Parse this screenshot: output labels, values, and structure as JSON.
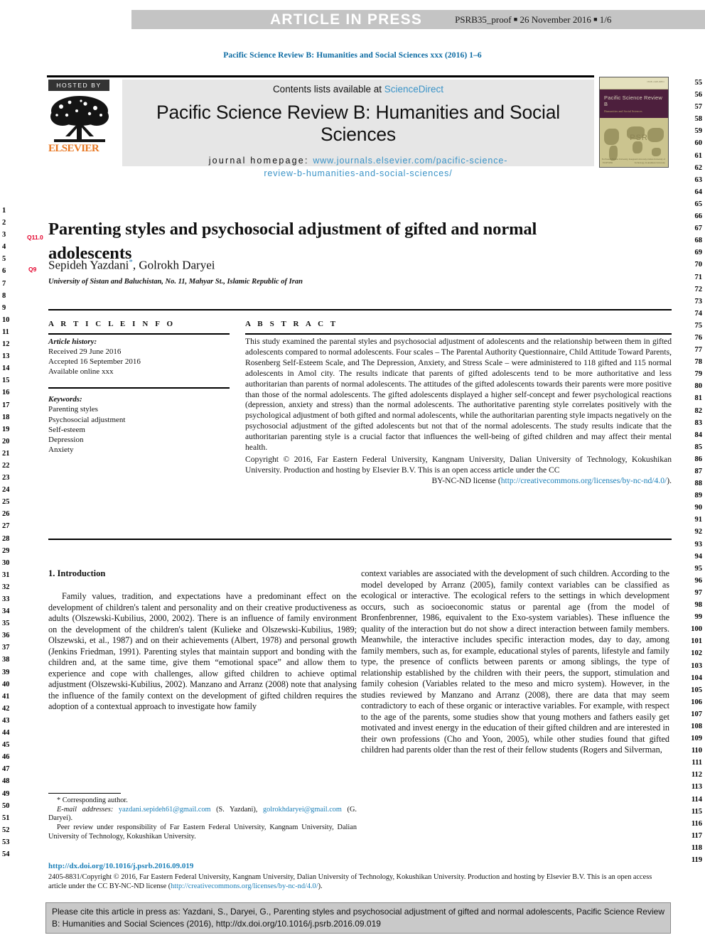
{
  "banner": {
    "label": "ARTICLE IN PRESS",
    "proof_id": "PSRB35_proof",
    "proof_date": "26 November 2016",
    "proof_page": "1/6"
  },
  "running_head": "Pacific Science Review B: Humanities and Social Sciences xxx (2016) 1–6",
  "masthead": {
    "hosted_by": "HOSTED BY",
    "publisher": "ELSEVIER",
    "contents_prefix": "Contents lists available at ",
    "contents_link": "ScienceDirect",
    "journal_title": "Pacific Science Review B: Humanities and Social Sciences",
    "homepage_label": "journal homepage: ",
    "homepage_url_line1": "www.journals.elsevier.com/pacific-science-",
    "homepage_url_line2": "review-b-humanities-and-social-sciences/"
  },
  "cover": {
    "title": "Pacific Science Review B",
    "subtitle": "Humanities and Social Sciences",
    "mark": "PSR",
    "footer": "Far Eastern Federal University, Kangnam University,\nDalian University of Technology, Kokushikan University",
    "publisher": "ELSEVIER"
  },
  "article": {
    "title": "Parenting styles and psychosocial adjustment of gifted and normal adolescents",
    "query_tag_title": "Q11.0",
    "query_tag_authors": "Q9",
    "authors": "Sepideh Yazdani, Golrokh Daryei",
    "author_1": "Sepideh Yazdani",
    "author_1_mark": "*",
    "author_2": "Golrokh Daryei",
    "affiliation": "University of Sistan and Baluchistan, No. 11, Mahyar St., Islamic Republic of Iran"
  },
  "info": {
    "heading": "A R T I C L E   I N F O",
    "history_label": "Article history:",
    "received": "Received 29 June 2016",
    "accepted": "Accepted 16 September 2016",
    "available": "Available online xxx",
    "keywords_label": "Keywords:",
    "keywords": [
      "Parenting styles",
      "Psychosocial adjustment",
      "Self-esteem",
      "Depression",
      "Anxiety"
    ]
  },
  "abstract": {
    "heading": "A B S T R A C T",
    "body": "This study examined the parental styles and psychosocial adjustment of adolescents and the relationship between them in gifted adolescents compared to normal adolescents. Four scales – The Parental Authority Questionnaire, Child Attitude Toward Parents, Rosenberg Self-Esteem Scale, and The Depression, Anxiety, and Stress Scale – were administered to 118 gifted and 115 normal adolescents in Amol city. The results indicate that parents of gifted adolescents tend to be more authoritative and less authoritarian than parents of normal adolescents. The attitudes of the gifted adolescents towards their parents were more positive than those of the normal adolescents. The gifted adolescents displayed a higher self-concept and fewer psychological reactions (depression, anxiety and stress) than the normal adolescents. The authoritative parenting style correlates positively with the psychological adjustment of both gifted and normal adolescents, while the authoritarian parenting style impacts negatively on the psychosocial adjustment of the gifted adolescents but not that of the normal adolescents. The study results indicate that the authoritarian parenting style is a crucial factor that influences the well-being of gifted children and may affect their mental health.",
    "copyright": "Copyright © 2016, Far Eastern Federal University, Kangnam University, Dalian University of Technology, Kokushikan University. Production and hosting by Elsevier B.V. This is an open access article under the CC",
    "license_prefix": "BY-NC-ND license (",
    "license_url": "http://creativecommons.org/licenses/by-nc-nd/4.0/",
    "license_suffix": ")."
  },
  "body": {
    "section_heading": "1. Introduction",
    "left_paragraph": "Family values, tradition, and expectations have a predominant effect on the development of children's talent and personality and on their creative productiveness as adults (Olszewski-Kubilius, 2000, 2002). There is an influence of family environment on the development of the children's talent (Kulieke and Olszewski-Kubilius, 1989; Olszewski, et al., 1987) and on their achievements (Albert, 1978) and personal growth (Jenkins Friedman, 1991). Parenting styles that maintain support and bonding with the children and, at the same time, give them “emotional space” and allow them to experience and cope with challenges, allow gifted children to achieve optimal adjustment (Olszewski-Kubilius, 2002). Manzano and Arranz (2008) note that analysing the influence of the family context on the development of gifted children requires the adoption of a contextual approach to investigate how family",
    "right_paragraph": "context variables are associated with the development of such children. According to the model developed by Arranz (2005), family context variables can be classified as ecological or interactive. The ecological refers to the settings in which development occurs, such as socioeconomic status or parental age (from the model of Bronfenbrenner, 1986, equivalent to the Exo-system variables). These influence the quality of the interaction but do not show a direct interaction between family members. Meanwhile, the interactive includes specific interaction modes, day to day, among family members, such as, for example, educational styles of parents, lifestyle and family type, the presence of conflicts between parents or among siblings, the type of relationship established by the children with their peers, the support, stimulation and family cohesion (Variables related to the meso and micro system). However, in the studies reviewed by Manzano and Arranz (2008), there are data that may seem contradictory to each of these organic or interactive variables. For example, with respect to the age of the parents, some studies show that young mothers and fathers easily get motivated and invest energy in the education of their gifted children and are interested in their own professions (Cho and Yoon, 2005), while other studies found that gifted children had parents older than the rest of their fellow students (Rogers and Silverman,"
  },
  "footnote": {
    "corresponding": "* Corresponding author.",
    "email_label": "E-mail addresses:",
    "email_1": "yazdani.sepideh61@gmail.com",
    "email_1_name": "(S. Yazdani),",
    "email_2": "golrokhdaryei@gmail.com",
    "email_2_name": "(G. Daryei).",
    "peer_review": "Peer review under responsibility of Far Eastern Federal University, Kangnam University, Dalian University of Technology, Kokushikan University.",
    "doi": "http://dx.doi.org/10.1016/j.psrb.2016.09.019",
    "copyright": "2405-8831/Copyright © 2016, Far Eastern Federal University, Kangnam University, Dalian University of Technology, Kokushikan University. Production and hosting by Elsevier B.V. This is an open access article under the CC BY-NC-ND license (",
    "copyright_url": "http://creativecommons.org/licenses/by-nc-nd/4.0/",
    "copyright_tail": ")."
  },
  "cite_box": {
    "text": "Please cite this article in press as: Yazdani, S., Daryei, G., Parenting styles and psychosocial adjustment of gifted and normal adolescents, Pacific Science Review B: Humanities and Social Sciences (2016), http://dx.doi.org/10.1016/j.psrb.2016.09.019"
  },
  "line_numbers": {
    "left_start": 1,
    "left_end": 54,
    "right_start": 55,
    "right_end": 119
  },
  "colors": {
    "link": "#1b7fb8",
    "banner_bg": "#c4c4c4",
    "panel_bg": "#e6e6e6",
    "query_red": "#e4002b",
    "elsevier_orange": "#e87722",
    "cover_band": "#4d1f3d"
  }
}
